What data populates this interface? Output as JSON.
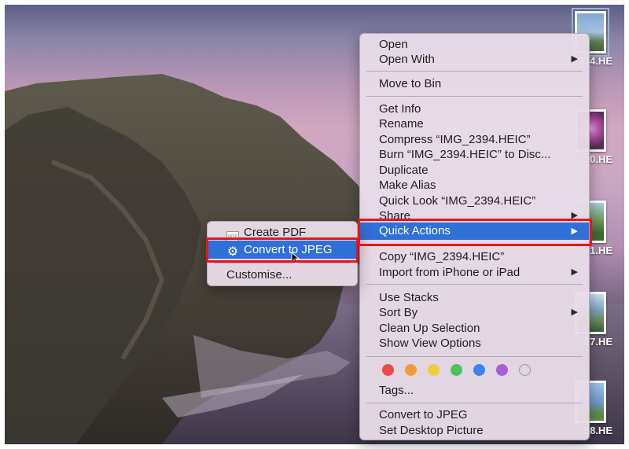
{
  "desktop_files": [
    {
      "name": "394.HE"
    },
    {
      "name": "10.HE"
    },
    {
      "name": "41.HE"
    },
    {
      "name": "27.HE"
    },
    {
      "name": "58.HE"
    }
  ],
  "menu": {
    "open": "Open",
    "open_with": "Open With",
    "move_to_bin": "Move to Bin",
    "get_info": "Get Info",
    "rename": "Rename",
    "compress": "Compress “IMG_2394.HEIC”",
    "burn": "Burn “IMG_2394.HEIC” to Disc...",
    "duplicate": "Duplicate",
    "make_alias": "Make Alias",
    "quick_look": "Quick Look “IMG_2394.HEIC”",
    "share": "Share",
    "quick_actions": "Quick Actions",
    "copy": "Copy “IMG_2394.HEIC”",
    "import_iphone": "Import from iPhone or iPad",
    "use_stacks": "Use Stacks",
    "sort_by": "Sort By",
    "clean_up": "Clean Up Selection",
    "show_view_options": "Show View Options",
    "tags": "Tags...",
    "convert_jpeg": "Convert to JPEG",
    "set_desktop_picture": "Set Desktop Picture",
    "submenu_arrow": "▶"
  },
  "tag_colors": [
    "#ec4a4a",
    "#f39a3a",
    "#f2cc3c",
    "#4cc35a",
    "#3a86e8",
    "#a55fd6",
    "#d8d8d8"
  ],
  "submenu": {
    "create_pdf": "Create PDF",
    "convert_jpeg": "Convert to JPEG",
    "customise": "Customise..."
  },
  "colors": {
    "highlight": "#2f6fd8",
    "annotation_box": "#e8141b"
  }
}
